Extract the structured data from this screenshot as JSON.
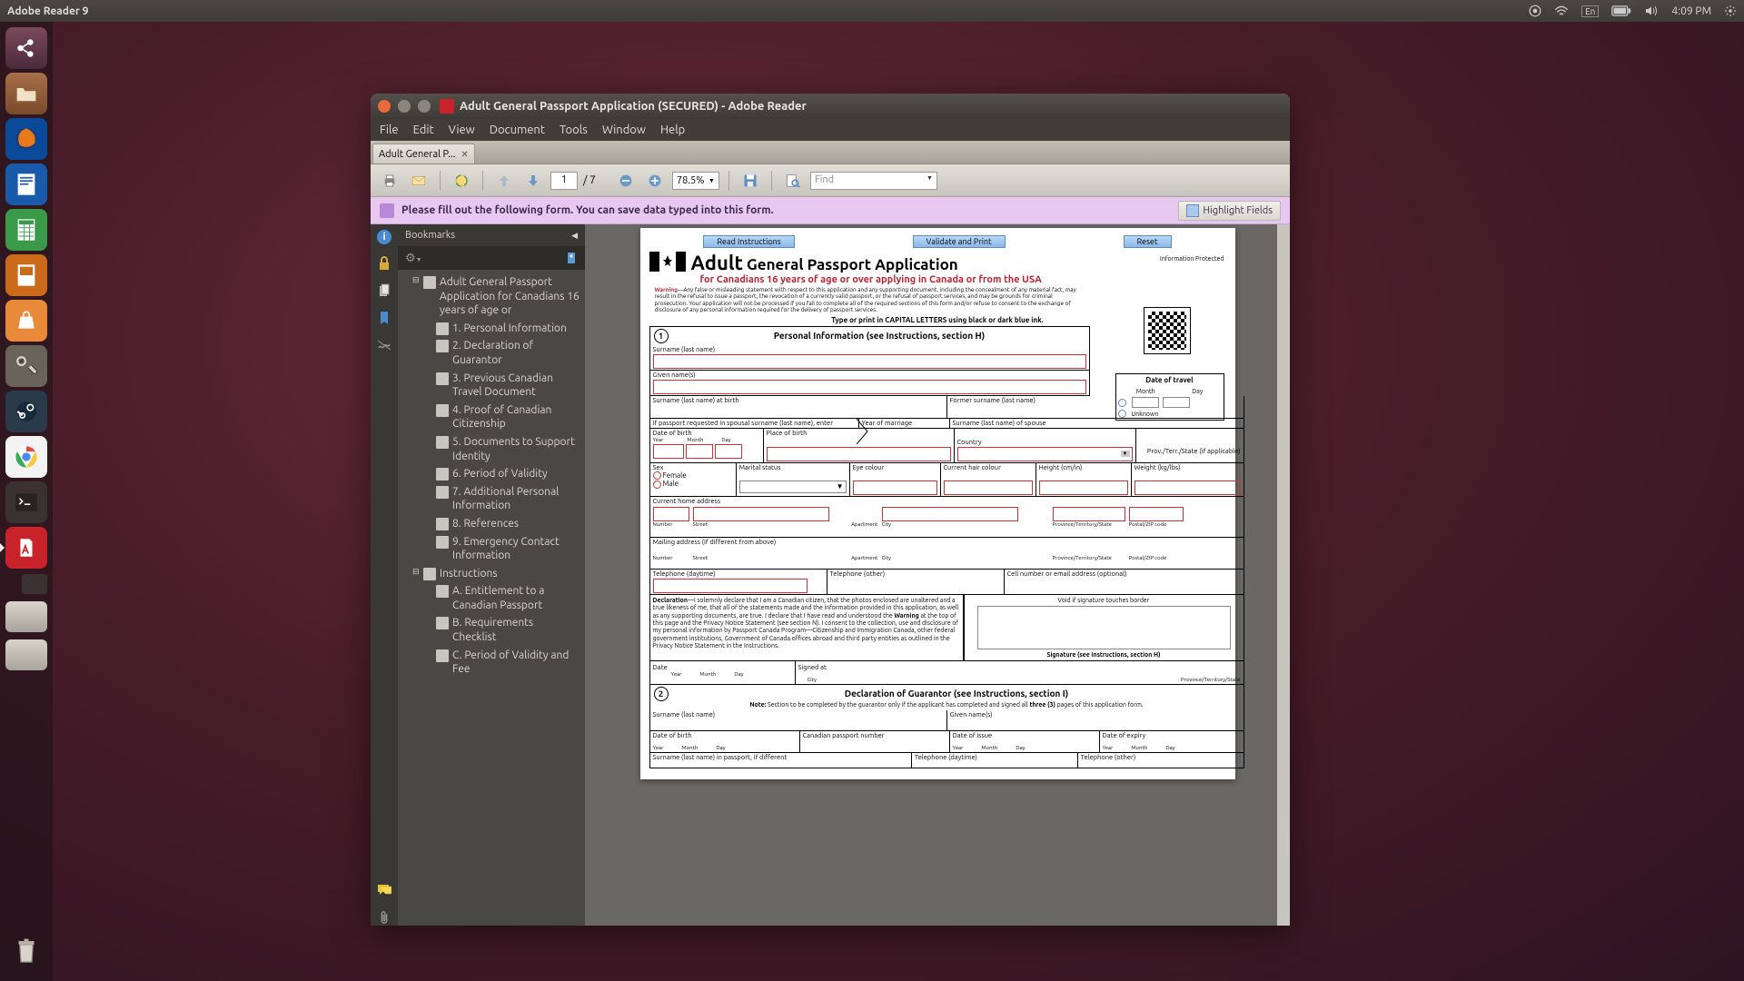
{
  "topbar": {
    "app": "Adobe Reader 9",
    "lang": "En",
    "time": "4:09 PM"
  },
  "launcher_items": [
    "dash",
    "files",
    "firefox",
    "writer",
    "calc",
    "impress",
    "software",
    "settings",
    "steam",
    "chrome",
    "terminal",
    "reader"
  ],
  "win": {
    "title": "Adult General Passport Application (SECURED) - Adobe Reader",
    "menu": [
      "File",
      "Edit",
      "View",
      "Document",
      "Tools",
      "Window",
      "Help"
    ],
    "tab": "Adult General P...",
    "page_cur": "1",
    "page_total": "/ 7",
    "zoom": "78.5%",
    "find_placeholder": "Find",
    "msg": "Please fill out the following form. You can save data typed into this form.",
    "hilite": "Highlight Fields"
  },
  "bookmarks": {
    "title": "Bookmarks",
    "items": [
      {
        "level": 1,
        "exp": "⊟",
        "txt": "Adult General Passport Application for Canadians 16 years of age or"
      },
      {
        "level": 2,
        "txt": "1. Personal Information"
      },
      {
        "level": 2,
        "txt": "2. Declaration of Guarantor"
      },
      {
        "level": 2,
        "txt": "3. Previous Canadian Travel Document"
      },
      {
        "level": 2,
        "txt": "4. Proof of Canadian Citizenship"
      },
      {
        "level": 2,
        "txt": "5. Documents to Support Identity"
      },
      {
        "level": 2,
        "txt": "6. Period of Validity"
      },
      {
        "level": 2,
        "txt": "7. Additional Personal Information"
      },
      {
        "level": 2,
        "txt": "8. References"
      },
      {
        "level": 2,
        "txt": "9. Emergency Contact Information"
      },
      {
        "level": 1,
        "exp": "⊟",
        "txt": "Instructions"
      },
      {
        "level": 2,
        "txt": "A. Entitlement to a Canadian Passport"
      },
      {
        "level": 2,
        "txt": "B. Requirements Checklist"
      },
      {
        "level": 2,
        "txt": "C. Period of Validity and Fee"
      }
    ]
  },
  "form": {
    "btns": [
      "Read Instructions",
      "Validate and Print",
      "Reset"
    ],
    "protected": "Information Protected",
    "h1_bold": "Adult",
    "h1_rest": "General Passport Application",
    "sub": "for Canadians 16 years of age or over applying in Canada or from the USA",
    "warn_label": "Warning",
    "warn": "—Any false or misleading statement with respect to this application and any supporting document, including the concealment of any material fact, may result in the refusal to issue a passport, the revocation of a currently valid passport, or the refusal of passport services, and may be grounds for criminal prosecution. Your application will not be processed if you fail to complete all of the required sections of this form and/or refuse to consent to the exchange of disclosure of any personal information required for the delivery of passport services.",
    "typeline": "Type or print in CAPITAL LETTERS using black or dark blue ink.",
    "dot": {
      "title": "Date of travel",
      "month": "Month",
      "day": "Day",
      "unknown": "Unknown"
    },
    "s1": {
      "num": "1",
      "title": "Personal Information (see Instructions, section H)",
      "surname": "Surname (last name)",
      "given": "Given name(s)",
      "surname_birth": "Surname (last name) at birth",
      "former": "Former surname (last name)",
      "spousal": "If passport requested in spousal surname (last name), enter",
      "yom": "Year of marriage",
      "spouse_surname": "Surname (last name) of spouse",
      "dob": "Date of birth",
      "y": "Year",
      "m": "Month",
      "d": "Day",
      "pob": "Place of birth",
      "country": "Country",
      "provterr": "Prov./Terr./State (if applicable)",
      "sex": "Sex",
      "female": "Female",
      "male": "Male",
      "marital": "Marital status",
      "eye": "Eye colour",
      "hair": "Current hair colour",
      "height": "Height (cm/in)",
      "weight": "Weight (kg/lbs)",
      "addr": "Current home address",
      "num_l": "Number",
      "street": "Street",
      "apt": "Apartment",
      "city": "City",
      "pts": "Province/Territory/State",
      "zip": "Postal/ZIP code",
      "mail": "Mailing address (if different from above)",
      "tel_day": "Telephone (daytime)",
      "tel_other": "Telephone (other)",
      "cell": "Cell number or email address (optional)",
      "decl_l": "Declaration",
      "decl": "—I solemnly declare that I am a Canadian citizen, that the photos enclosed are unaltered and a true likeness of me, that all of the statements made and the information provided in this application, as well as any supporting documents, are true. I declare that I have read and understood the ",
      "decl2": " at the top of this page and the Privacy Notice Statement (see section N). I consent to the collection, use and disclosure of my personal information by Passport Canada Program—Citizenship and Immigration Canada, other federal government institutions, Government of Canada offices abroad and third party entities as outlined in the Privacy Notice Statement in the Instructions.",
      "void": "Void if signature touches border",
      "sig": "Signature (see Instructions, section H)",
      "date": "Date",
      "signed": "Signed at"
    },
    "s2": {
      "num": "2",
      "title": "Declaration of Guarantor (see Instructions, section I)",
      "note_l": "Note:",
      "note": " Section to be completed by the guarantor only if the applicant has completed and signed all ",
      "three": "three (3)",
      "note2": " pages of this application form.",
      "surname": "Surname (last name)",
      "given": "Given name(s)",
      "dob": "Date of birth",
      "cpn": "Canadian passport number",
      "doi": "Date of issue",
      "doe": "Date of expiry",
      "surname_pp": "Surname (last name) in passport, if different",
      "tel_day": "Telephone (daytime)",
      "tel_other": "Telephone (other)"
    }
  }
}
